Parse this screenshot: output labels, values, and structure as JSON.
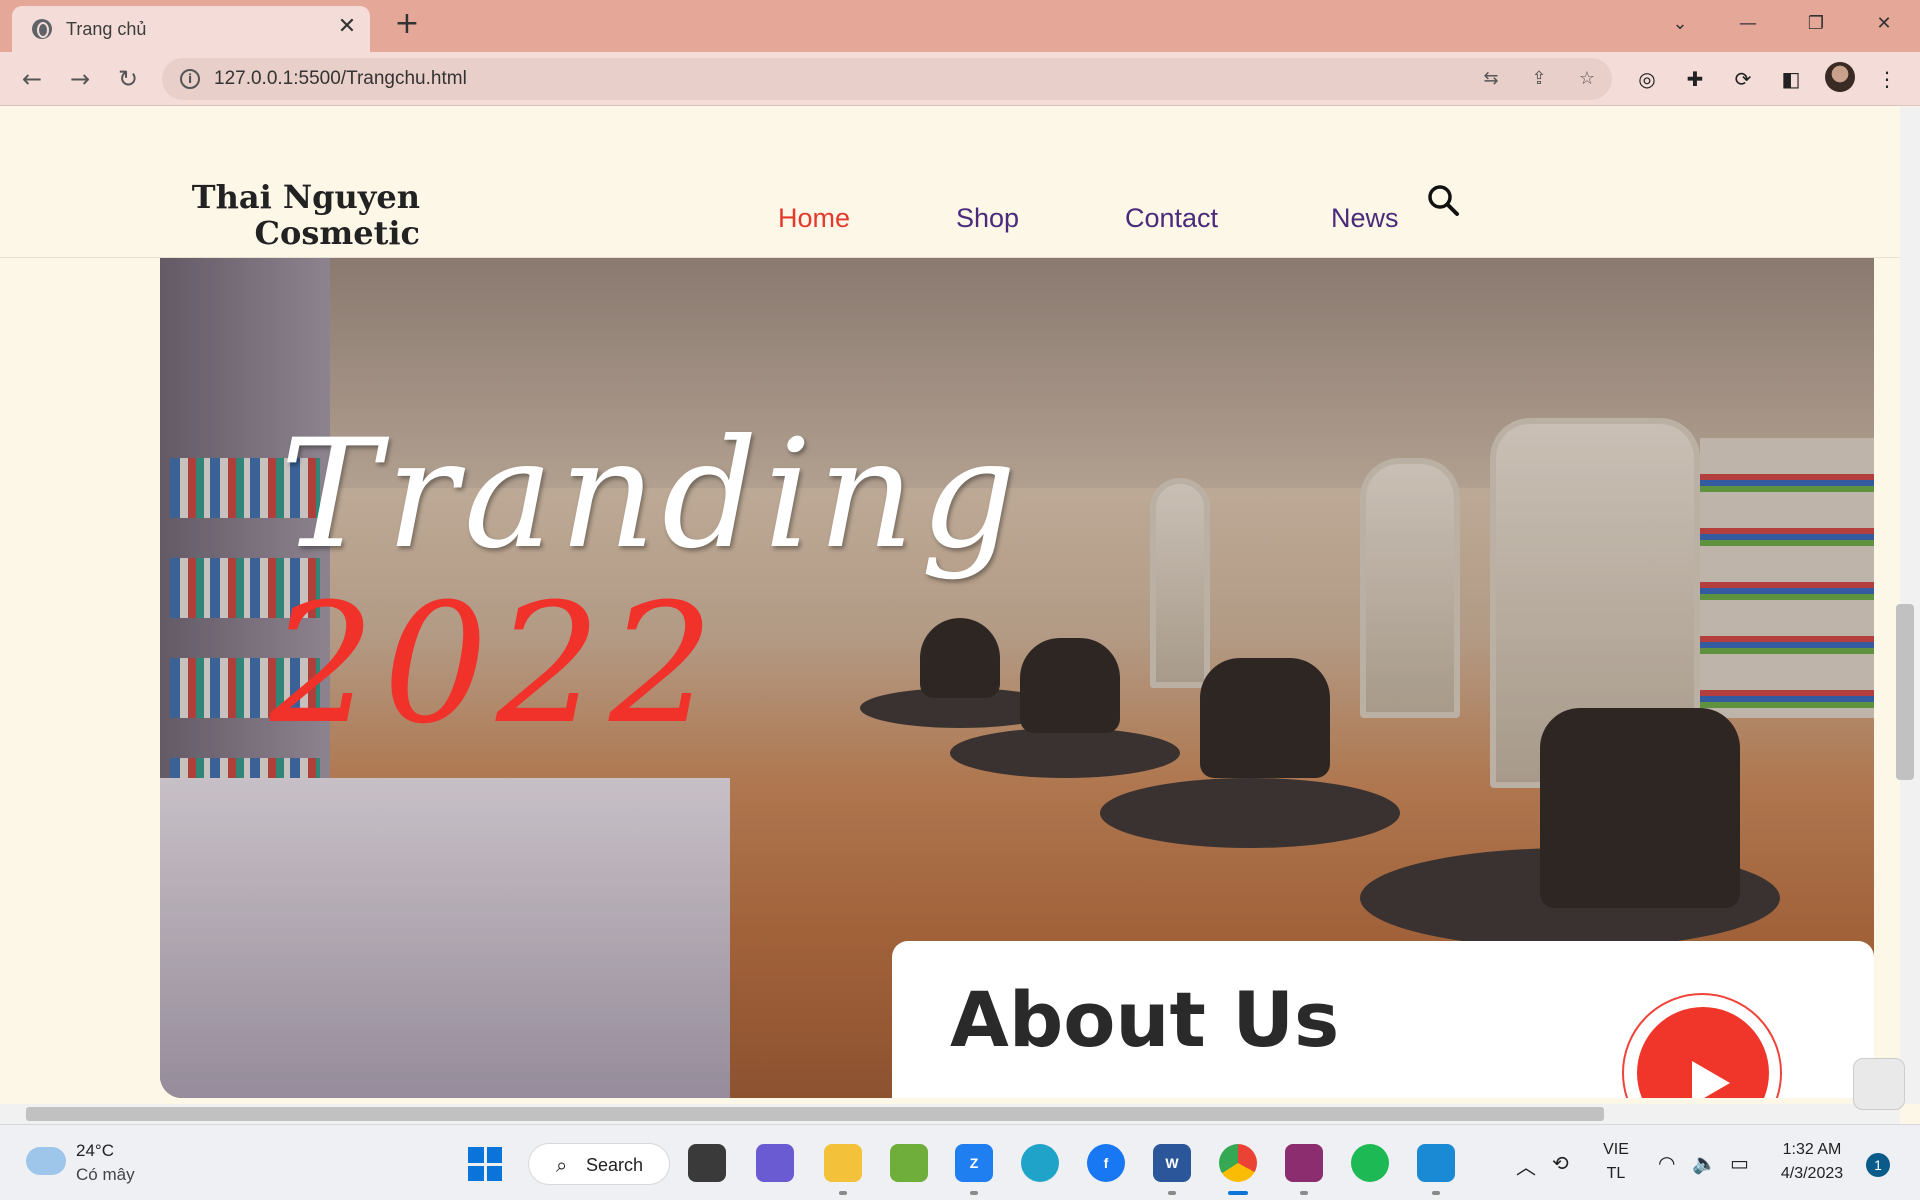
{
  "browser": {
    "tab_title": "Trang chủ",
    "url": "127.0.0.1:5500/Trangchu.html"
  },
  "site": {
    "logo": "Thai Nguyen Cosmetic",
    "nav": [
      {
        "label": "Home",
        "active": true
      },
      {
        "label": "Shop",
        "active": false
      },
      {
        "label": "Contact",
        "active": false
      },
      {
        "label": "News",
        "active": false
      }
    ],
    "hero": {
      "title": "Tranding",
      "year": "2022"
    },
    "about": {
      "title": "About Us"
    }
  },
  "colors": {
    "nav_active": "#e23b2e",
    "nav_link": "#4a2a7a",
    "accent_red": "#f0362b",
    "page_bg": "#fdf7e8",
    "chrome_bg": "#e4a798"
  },
  "taskbar": {
    "weather_temp": "24°C",
    "weather_desc": "Có mây",
    "search_label": "Search",
    "language": "VIE",
    "language_sub": "TL",
    "time": "1:32 AM",
    "date": "4/3/2023",
    "notification_count": "1"
  }
}
